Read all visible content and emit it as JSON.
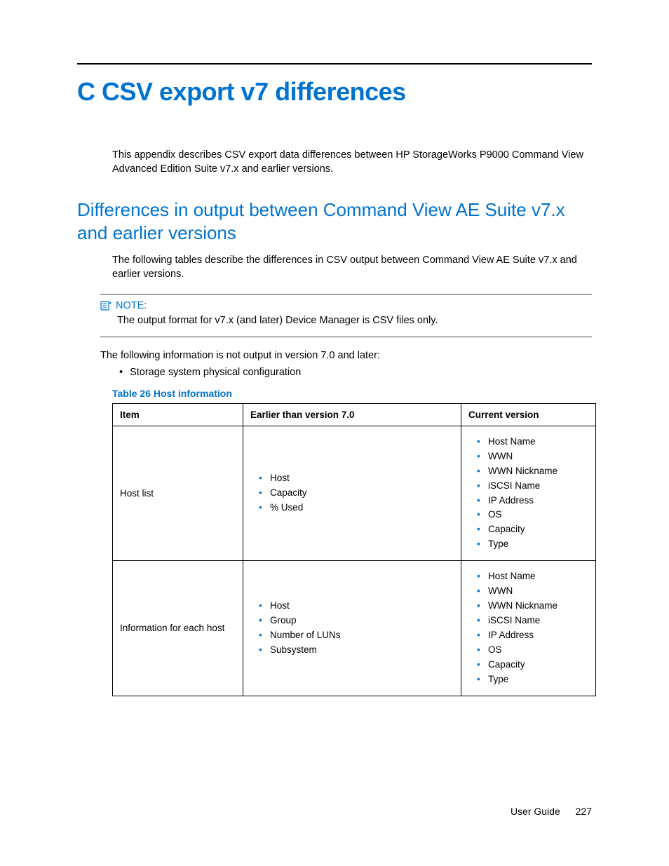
{
  "heading": "C CSV export v7 differences",
  "intro": "This appendix describes CSV export data differences between HP StorageWorks P9000 Command View Advanced Edition Suite v7.x and earlier versions.",
  "subheading": "Differences in output between Command View AE Suite v7.x and earlier versions",
  "subintro": "The following tables describe the differences in CSV output between Command View AE Suite v7.x and earlier versions.",
  "note": {
    "label": "NOTE:",
    "body": "The output format for v7.x (and later) Device Manager is CSV files only."
  },
  "not_output_text": "The following information is not output in version 7.0 and later:",
  "not_output_items": [
    "Storage system physical configuration"
  ],
  "table": {
    "caption": "Table 26 Host information",
    "headers": [
      "Item",
      "Earlier than version 7.0",
      "Current version"
    ],
    "rows": [
      {
        "item": "Host list",
        "earlier": [
          "Host",
          "Capacity",
          "% Used"
        ],
        "current": [
          "Host Name",
          "WWN",
          "WWN Nickname",
          "iSCSI Name",
          "IP Address",
          "OS",
          "Capacity",
          "Type"
        ]
      },
      {
        "item": "Information for each host",
        "earlier": [
          "Host",
          "Group",
          "Number of LUNs",
          "Subsystem"
        ],
        "current": [
          "Host Name",
          "WWN",
          "WWN Nickname",
          "iSCSI Name",
          "IP Address",
          "OS",
          "Capacity",
          "Type"
        ]
      }
    ]
  },
  "footer": {
    "label": "User Guide",
    "page": "227"
  }
}
